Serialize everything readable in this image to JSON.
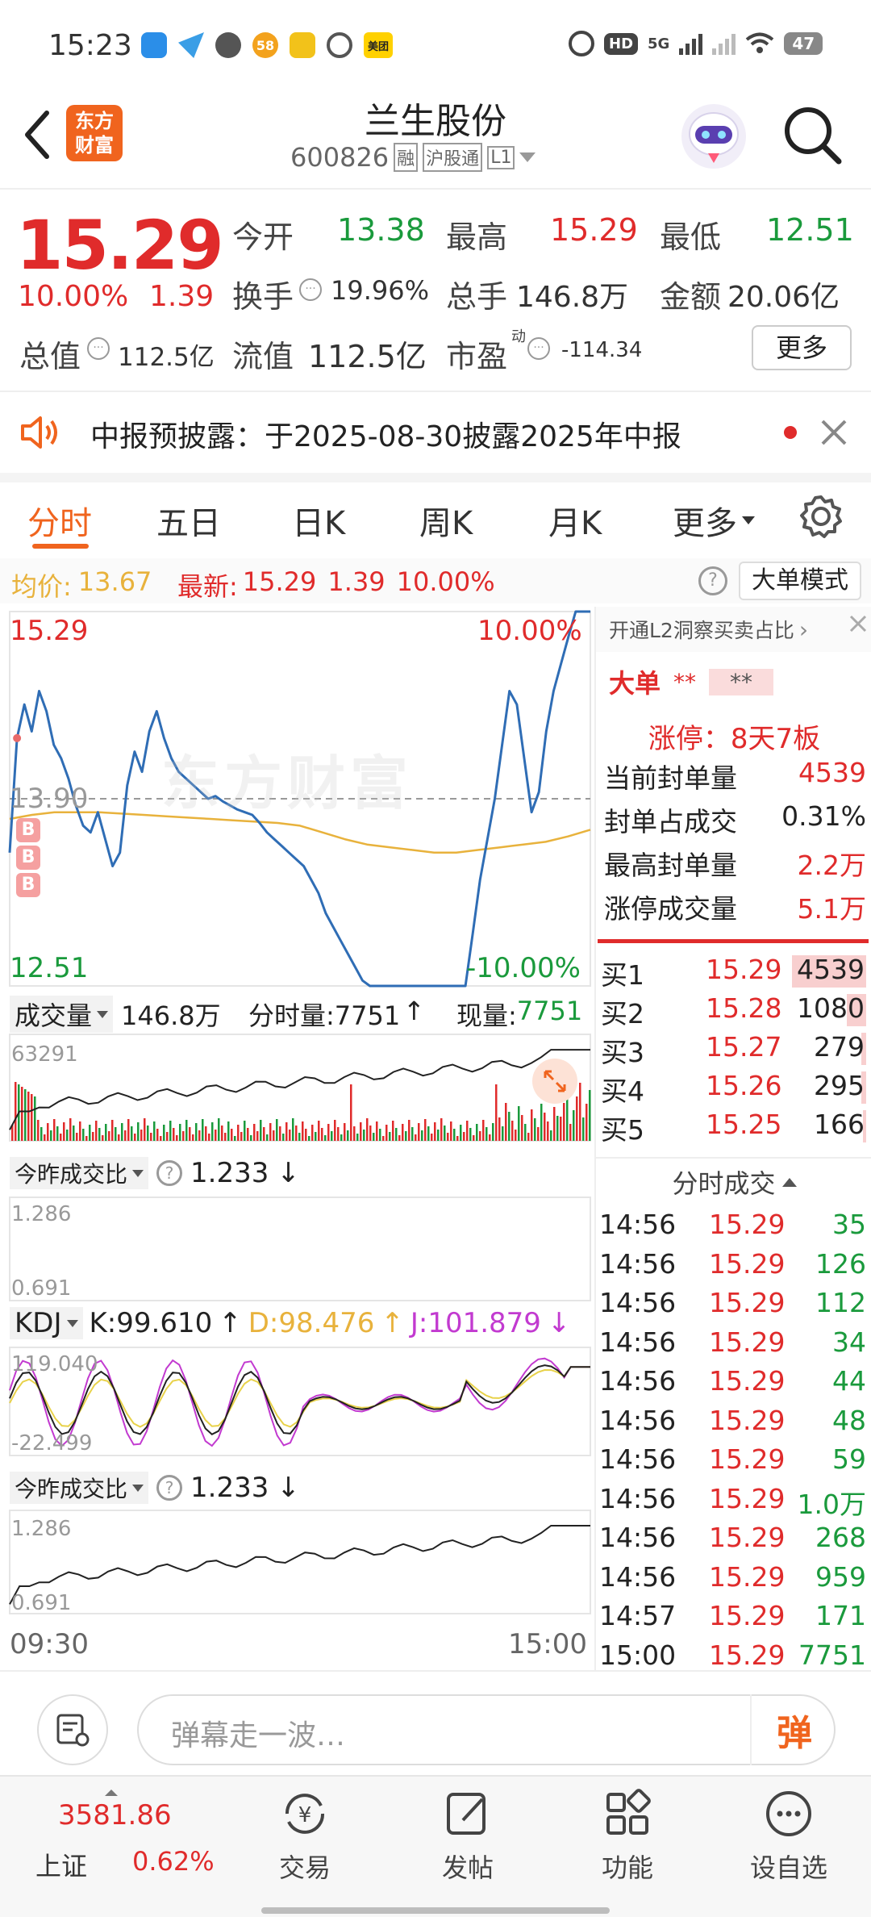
{
  "status_bar": {
    "time": "15:23",
    "app_icon_names": [
      "notification-icon-1",
      "notification-icon-2",
      "notification-icon-3",
      "notification-icon-4",
      "notification-icon-5",
      "notification-icon-6"
    ],
    "meituan_label": "美团",
    "app_58_label": "58",
    "hd_label": "HD",
    "signal_label": "5G",
    "battery": "47"
  },
  "header": {
    "brand_line1": "东方",
    "brand_line2": "财富",
    "stock_name": "兰生股份",
    "stock_code": "600826",
    "tag_rong": "融",
    "tag_hgt": "沪股通",
    "tag_l1": "L1"
  },
  "quote": {
    "price": "15.29",
    "change_pct": "10.00%",
    "change_amt": "1.39",
    "open_label": "今开",
    "open_value": "13.38",
    "high_label": "最高",
    "high_value": "15.29",
    "low_label": "最低",
    "low_value": "12.51",
    "turnover_label": "换手",
    "turnover_value": "19.96%",
    "volume_label": "总手",
    "volume_value": "146.8万",
    "amount_label": "金额",
    "amount_value": "20.06亿",
    "mktcap_label": "总值",
    "mktcap_value": "112.5亿",
    "float_label": "流值",
    "float_value": "112.5亿",
    "pe_label": "市盈",
    "pe_sup": "动",
    "pe_value": "-114.34",
    "more_button": "更多"
  },
  "notice": {
    "text": "中报预披露：于2025-08-30披露2025年中报"
  },
  "tabs": [
    "分时",
    "五日",
    "日K",
    "周K",
    "月K",
    "更多"
  ],
  "chart_info": {
    "avg_label": "均价:",
    "avg_value": "13.67",
    "latest_label": "最新:",
    "latest_value": "15.29",
    "latest_change": "1.39",
    "latest_pct": "10.00%",
    "big_order_mode": "大单模式"
  },
  "main_chart": {
    "top_left": "15.29",
    "top_right": "10.00%",
    "mid_left": "13.90",
    "bottom_left": "12.51",
    "bottom_right": "-10.00%",
    "b_marker": "B",
    "watermark": "东方财富",
    "time_start": "09:30",
    "time_end": "15:00"
  },
  "volume_panel": {
    "label": "成交量",
    "total": "146.8万",
    "minute_label": "分时量:7751",
    "now_label": "现量:",
    "now_value": "7751",
    "max_value": "63291"
  },
  "ratio_panel": {
    "label": "今昨成交比",
    "value": "1.233",
    "top": "1.286",
    "bottom": "0.691"
  },
  "kdj_panel": {
    "label": "KDJ",
    "k": "K:99.610",
    "d": "D:98.476",
    "j": "J:101.879",
    "top": "119.040",
    "bottom": "-22.499"
  },
  "ratio_panel2": {
    "label": "今昨成交比",
    "value": "1.233",
    "top": "1.286",
    "bottom": "0.691"
  },
  "side_panel": {
    "l2_link": "开通L2洞察买卖占比",
    "big_order_label": "大单",
    "big_order_v1": "**",
    "big_order_v2": "**",
    "limit_label": "涨停：8天7板",
    "rows": [
      {
        "label": "当前封单量",
        "value": "4539"
      },
      {
        "label": "封单占成交",
        "value": "0.31%"
      },
      {
        "label": "最高封单量",
        "value": "2.2万"
      },
      {
        "label": "涨停成交量",
        "value": "5.1万"
      }
    ],
    "bids": [
      {
        "label": "买1",
        "price": "15.29",
        "vol": "4539"
      },
      {
        "label": "买2",
        "price": "15.28",
        "vol": "1080"
      },
      {
        "label": "买3",
        "price": "15.27",
        "vol": "279"
      },
      {
        "label": "买4",
        "price": "15.26",
        "vol": "295"
      },
      {
        "label": "买5",
        "price": "15.25",
        "vol": "166"
      }
    ],
    "trades_title": "分时成交",
    "trades": [
      {
        "time": "14:56",
        "price": "15.29",
        "vol": "35"
      },
      {
        "time": "14:56",
        "price": "15.29",
        "vol": "126"
      },
      {
        "time": "14:56",
        "price": "15.29",
        "vol": "112"
      },
      {
        "time": "14:56",
        "price": "15.29",
        "vol": "34"
      },
      {
        "time": "14:56",
        "price": "15.29",
        "vol": "44"
      },
      {
        "time": "14:56",
        "price": "15.29",
        "vol": "48"
      },
      {
        "time": "14:56",
        "price": "15.29",
        "vol": "59"
      },
      {
        "time": "14:56",
        "price": "15.29",
        "vol": "1.0万"
      },
      {
        "time": "14:56",
        "price": "15.29",
        "vol": "268"
      },
      {
        "time": "14:56",
        "price": "15.29",
        "vol": "959"
      },
      {
        "time": "14:57",
        "price": "15.29",
        "vol": "171"
      },
      {
        "time": "15:00",
        "price": "15.29",
        "vol": "7751"
      }
    ]
  },
  "comment_bar": {
    "placeholder": "弹幕走一波…",
    "danmu_button": "弹"
  },
  "bottom_nav": {
    "index_value": "3581.86",
    "index_name": "上证",
    "index_pct": "0.62%",
    "items": [
      "交易",
      "发帖",
      "功能",
      "设自选"
    ]
  },
  "colors": {
    "up": "#e02b2b",
    "down": "#1a9a3c",
    "accent": "#f0641e",
    "price_line": "#2f6db5",
    "avg_line": "#e8b23c"
  },
  "chart_data": [
    {
      "type": "line",
      "title": "",
      "xlabel": "",
      "ylabel": "",
      "x_range": [
        "09:30",
        "15:00"
      ],
      "ylim": [
        12.51,
        15.29
      ],
      "reference": 13.9,
      "series": [
        {
          "values": [
            13.5,
            14.35,
            14.6,
            14.4,
            14.7,
            14.55,
            14.3,
            14.2,
            14.05,
            13.85,
            13.7,
            13.65,
            13.8,
            13.6,
            13.4,
            13.5,
            14.0,
            14.25,
            14.1,
            14.4,
            14.55,
            14.35,
            14.2,
            14.1,
            14.05,
            14.0,
            13.95,
            13.9,
            13.92,
            13.88,
            13.85,
            13.82,
            13.8,
            13.78,
            13.72,
            13.65,
            13.6,
            13.55,
            13.5,
            13.45,
            13.4,
            13.3,
            13.2,
            13.05,
            12.95,
            12.85,
            12.75,
            12.65,
            12.55,
            12.51,
            12.51,
            12.51,
            12.51,
            12.51,
            12.51,
            12.51,
            12.51,
            12.51,
            12.51,
            12.51,
            12.51,
            12.51,
            12.51,
            12.9,
            13.3,
            13.6,
            13.9,
            14.3,
            14.7,
            14.6,
            14.2,
            13.8,
            13.95,
            14.4,
            14.7,
            14.9,
            15.1,
            15.29,
            15.29,
            15.29
          ]
        },
        {
          "values": [
            13.75,
            13.78,
            13.8,
            13.8,
            13.8,
            13.79,
            13.78,
            13.77,
            13.76,
            13.75,
            13.74,
            13.73,
            13.72,
            13.7,
            13.65,
            13.6,
            13.56,
            13.54,
            13.52,
            13.5,
            13.5,
            13.52,
            13.54,
            13.56,
            13.58,
            13.62,
            13.67
          ]
        }
      ]
    },
    {
      "type": "bar",
      "title": "",
      "ylim": [
        0,
        63291
      ],
      "categories": [
        "09:30",
        "15:00"
      ],
      "values": [
        63291,
        7751
      ]
    }
  ]
}
